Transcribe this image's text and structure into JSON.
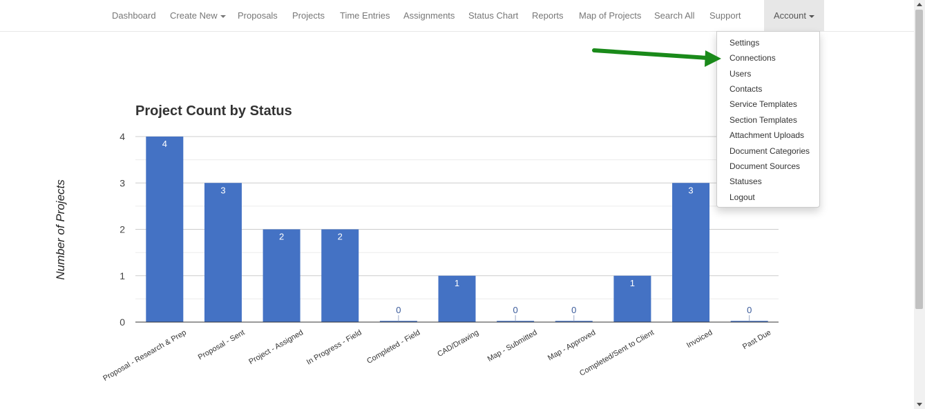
{
  "navbar": {
    "items": [
      {
        "label": "Dashboard"
      },
      {
        "label": "Create New",
        "caret": true
      },
      {
        "label": "Proposals"
      },
      {
        "label": "Projects"
      },
      {
        "label": "Time Entries"
      },
      {
        "label": "Assignments"
      },
      {
        "label": "Status Chart"
      },
      {
        "label": "Reports"
      },
      {
        "label": "Map of Projects"
      },
      {
        "label": "Search All"
      },
      {
        "label": "Support"
      }
    ],
    "account": {
      "label": "Account"
    }
  },
  "account_menu": {
    "items": [
      "Settings",
      "Connections",
      "Users",
      "Contacts",
      "Service Templates",
      "Section Templates",
      "Attachment Uploads",
      "Document Categories",
      "Document Sources",
      "Statuses",
      "Logout"
    ]
  },
  "annotation": {
    "color": "#1a8a1a",
    "points_to": "Connections"
  },
  "chart_data": {
    "type": "bar",
    "title": "Project Count by Status",
    "ylabel": "Number of Projects",
    "xlabel": "",
    "ylim": [
      0,
      4
    ],
    "yticks": [
      0,
      1,
      2,
      3,
      4
    ],
    "grid": true,
    "bar_color": "#4472c4",
    "categories": [
      "Proposal - Research & Prep",
      "Proposal - Sent",
      "Project - Assigned",
      "In Progress - Field",
      "Completed - Field",
      "CAD/Drawing",
      "Map - Submitted",
      "Map - Approved",
      "Completed/Sent to Client",
      "Invoiced",
      "Past Due"
    ],
    "values": [
      4,
      3,
      2,
      2,
      0,
      1,
      0,
      0,
      1,
      3,
      0
    ]
  }
}
